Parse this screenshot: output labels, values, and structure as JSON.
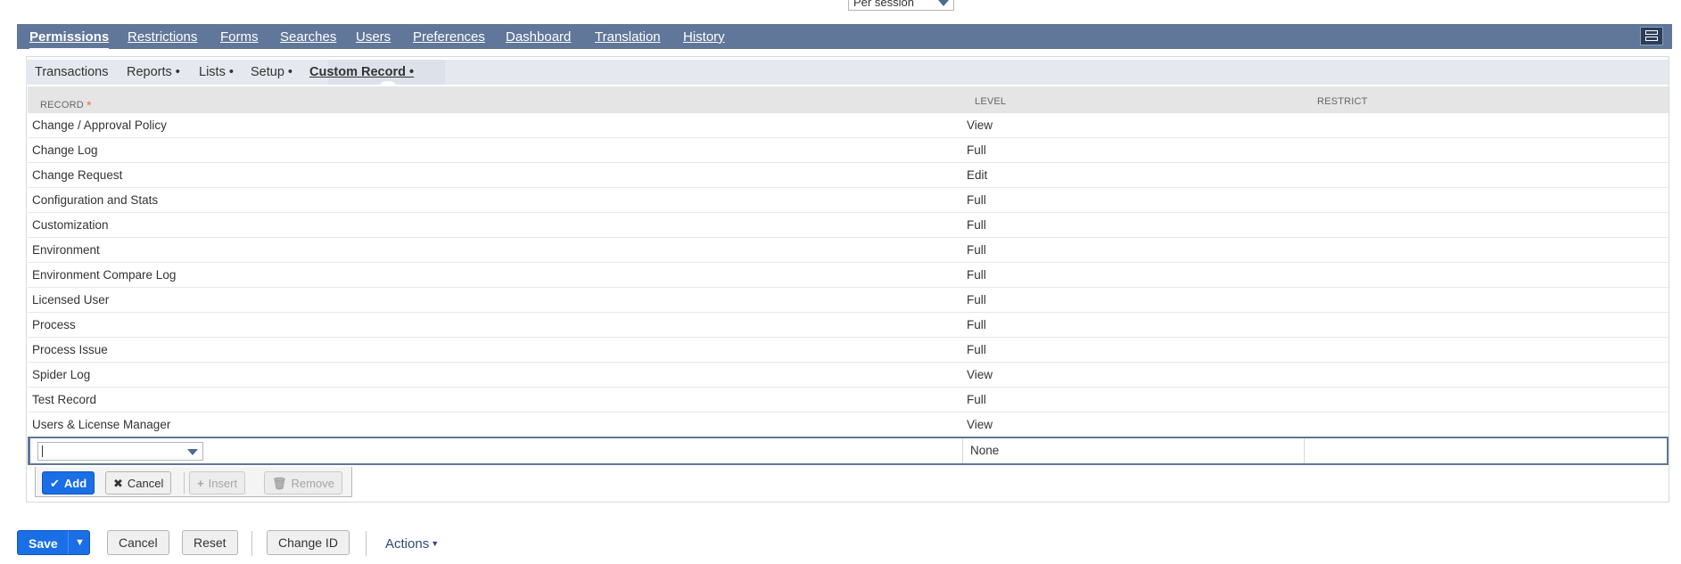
{
  "session_select": {
    "value": "Per session"
  },
  "main_tabs": [
    "Permissions",
    "Restrictions",
    "Forms",
    "Searches",
    "Users",
    "Preferences",
    "Dashboard",
    "Translation",
    "History"
  ],
  "sub_tabs": [
    "Transactions",
    "Reports •",
    "Lists •",
    "Setup •",
    "Custom Record •"
  ],
  "grid": {
    "columns": [
      "RECORD",
      "LEVEL",
      "RESTRICT"
    ],
    "required_marker": "*",
    "rows": [
      {
        "record": "Change / Approval Policy",
        "level": "View"
      },
      {
        "record": "Change Log",
        "level": "Full"
      },
      {
        "record": "Change Request",
        "level": "Edit"
      },
      {
        "record": "Configuration and Stats",
        "level": "Full"
      },
      {
        "record": "Customization",
        "level": "Full"
      },
      {
        "record": "Environment",
        "level": "Full"
      },
      {
        "record": "Environment Compare Log",
        "level": "Full"
      },
      {
        "record": "Licensed User",
        "level": "Full"
      },
      {
        "record": "Process",
        "level": "Full"
      },
      {
        "record": "Process Issue",
        "level": "Full"
      },
      {
        "record": "Spider Log",
        "level": "View"
      },
      {
        "record": "Test Record",
        "level": "Full"
      },
      {
        "record": "Users & License Manager",
        "level": "View"
      }
    ],
    "edit_row": {
      "record_value": "",
      "level": "None"
    }
  },
  "machine_buttons": {
    "add": "Add",
    "cancel": "Cancel",
    "insert": "Insert",
    "remove": "Remove"
  },
  "bottom_buttons": {
    "save": "Save",
    "cancel": "Cancel",
    "reset": "Reset",
    "change_id": "Change ID",
    "actions": "Actions"
  },
  "colors": {
    "tab_bar": "#607799",
    "primary": "#1a6ee6",
    "required": "#e8743b"
  }
}
